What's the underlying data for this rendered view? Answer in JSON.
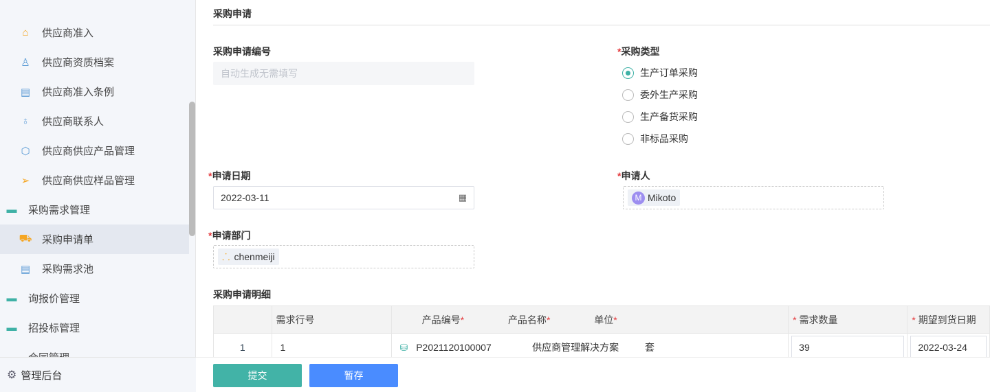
{
  "sidebar": {
    "items": [
      {
        "label": "供应商准入",
        "icon": "home-icon",
        "color": "#f5a623"
      },
      {
        "label": "供应商资质档案",
        "icon": "stamp-icon",
        "color": "#5b9bd5"
      },
      {
        "label": "供应商准入条例",
        "icon": "clipboard-icon",
        "color": "#5b9bd5"
      },
      {
        "label": "供应商联系人",
        "icon": "user-icon",
        "color": "#5b9bd5"
      },
      {
        "label": "供应商供应产品管理",
        "icon": "box-icon",
        "color": "#5b9bd5"
      },
      {
        "label": "供应商供应样品管理",
        "icon": "send-icon",
        "color": "#f5a623"
      },
      {
        "label": "采购需求管理",
        "icon": "folder-open-icon"
      },
      {
        "label": "采购申请单",
        "icon": "cart-icon",
        "color": "#f5a623"
      },
      {
        "label": "采购需求池",
        "icon": "clipboard-icon",
        "color": "#5b9bd5"
      },
      {
        "label": "询报价管理",
        "icon": "folder-icon"
      },
      {
        "label": "招投标管理",
        "icon": "folder-icon"
      },
      {
        "label": "合同管理",
        "icon": "folder-icon"
      }
    ],
    "footer": "管理后台"
  },
  "form": {
    "title": "采购申请",
    "code_label": "采购申请编号",
    "code_placeholder": "自动生成无需填写",
    "type_label": "采购类型",
    "types": [
      "生产订单采购",
      "委外生产采购",
      "生产备货采购",
      "非标品采购"
    ],
    "type_selected": "生产订单采购",
    "date_label": "申请日期",
    "date_value": "2022-03-11",
    "applicant_label": "申请人",
    "applicant": "Mikoto",
    "applicant_initial": "M",
    "dept_label": "申请部门",
    "dept": "chenmeiji",
    "detail_label": "采购申请明细"
  },
  "table": {
    "headers": [
      "",
      "需求行号",
      "产品编号",
      "产品名称",
      "单位",
      "需求数量",
      "期望到货日期"
    ],
    "rows": [
      {
        "index": "1",
        "line": "1",
        "code": "P2021120100007",
        "name": "供应商管理解决方案",
        "unit": "套",
        "qty": "39",
        "date": "2022-03-24"
      }
    ]
  },
  "buttons": {
    "submit": "提交",
    "save": "暂存"
  },
  "colors": {
    "accent": "#3fb1a6",
    "blue": "#4a8cff",
    "required": "#e4393c"
  }
}
